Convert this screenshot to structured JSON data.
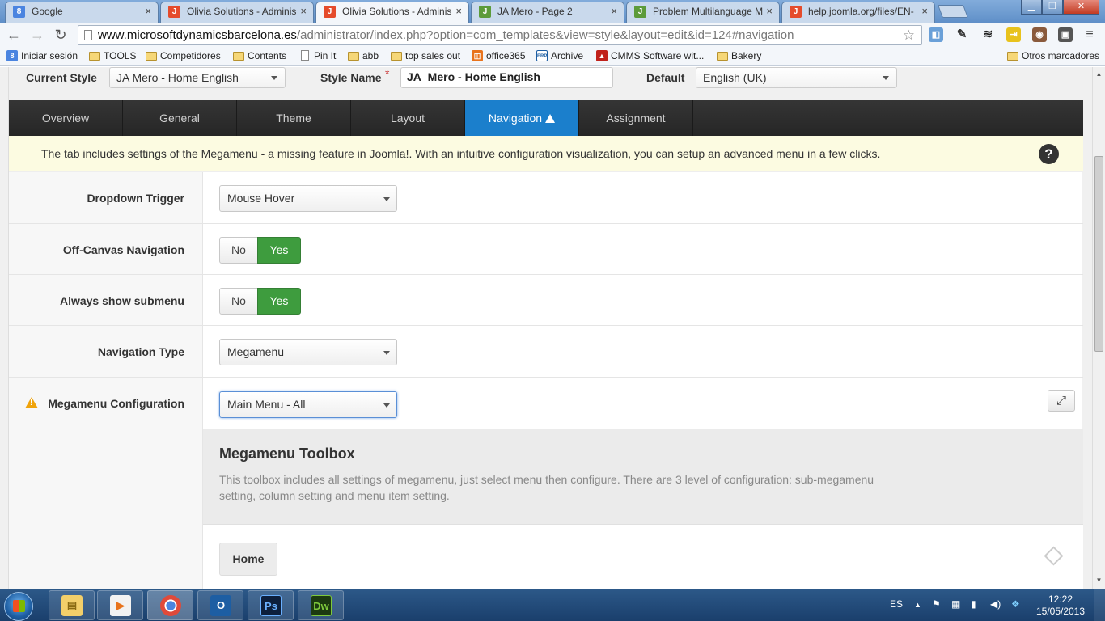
{
  "browser": {
    "tabs": [
      {
        "title": "Google",
        "favicon": "google-g-icon",
        "active": false
      },
      {
        "title": "Olivia Solutions - Adminis",
        "favicon": "joomla-icon",
        "active": false
      },
      {
        "title": "Olivia Solutions - Adminis",
        "favicon": "joomla-icon",
        "active": true
      },
      {
        "title": "JA Mero - Page 2",
        "favicon": "joomla-forum-icon",
        "active": false
      },
      {
        "title": "Problem Multilanguage M",
        "favicon": "joomla-forum-icon",
        "active": false
      },
      {
        "title": "help.joomla.org/files/EN-",
        "favicon": "joomla-icon",
        "active": false
      }
    ],
    "url_host": "www.microsoftdynamicsbarcelona.es",
    "url_path": "/administrator/index.php?option=com_templates&view=style&layout=edit&id=124#navigation",
    "bookmarks": [
      {
        "label": "Iniciar sesión",
        "icon": "google-icon"
      },
      {
        "label": "TOOLS",
        "icon": "folder-icon"
      },
      {
        "label": "Competidores",
        "icon": "folder-icon"
      },
      {
        "label": "Contents",
        "icon": "folder-icon"
      },
      {
        "label": "Pin It",
        "icon": "page-icon"
      },
      {
        "label": "abb",
        "icon": "folder-icon"
      },
      {
        "label": "top sales out",
        "icon": "folder-icon"
      },
      {
        "label": "office365",
        "icon": "office-icon"
      },
      {
        "label": "Archive",
        "icon": "erp-icon"
      },
      {
        "label": "CMMS Software wit...",
        "icon": "cmms-icon"
      },
      {
        "label": "Bakery",
        "icon": "folder-icon"
      }
    ],
    "other_bookmarks": "Otros marcadores"
  },
  "style_bar": {
    "current_style_label": "Current Style",
    "current_style_value": "JA Mero - Home English",
    "style_name_label": "Style Name",
    "style_name_required": "*",
    "style_name_value": "JA_Mero - Home English",
    "default_label": "Default",
    "default_value": "English (UK)"
  },
  "nav_tabs": [
    {
      "label": "Overview"
    },
    {
      "label": "General"
    },
    {
      "label": "Theme"
    },
    {
      "label": "Layout"
    },
    {
      "label": "Navigation",
      "active": true,
      "warning": true
    },
    {
      "label": "Assignment"
    }
  ],
  "notice": "The tab includes settings of the Megamenu - a missing feature in Joomla!. With an intuitive configuration visualization, you can setup an advanced menu in a few clicks.",
  "help_symbol": "?",
  "fields": {
    "dropdown_trigger": {
      "label": "Dropdown Trigger",
      "value": "Mouse Hover"
    },
    "off_canvas": {
      "label": "Off-Canvas Navigation",
      "no": "No",
      "yes": "Yes",
      "selected": "Yes"
    },
    "always_submenu": {
      "label": "Always show submenu",
      "no": "No",
      "yes": "Yes",
      "selected": "Yes"
    },
    "nav_type": {
      "label": "Navigation Type",
      "value": "Megamenu"
    },
    "megamenu_config": {
      "label": "Megamenu Configuration",
      "value": "Main Menu - All",
      "warning": true
    }
  },
  "toolbox": {
    "title": "Megamenu Toolbox",
    "description": "This toolbox includes all settings of megamenu, just select menu then configure. There are 3 level of configuration: sub-megamenu setting, column setting and menu item setting."
  },
  "menu_items": [
    {
      "label": "Home"
    }
  ],
  "taskbar": {
    "apps": [
      {
        "name": "explorer",
        "icon": "folder-icon"
      },
      {
        "name": "media-player",
        "icon": "media-player-icon"
      },
      {
        "name": "chrome",
        "icon": "chrome-icon"
      },
      {
        "name": "outlook",
        "label": "O",
        "icon": "outlook-icon"
      },
      {
        "name": "photoshop",
        "label": "Ps",
        "icon": "photoshop-icon"
      },
      {
        "name": "dreamweaver",
        "label": "Dw",
        "icon": "dreamweaver-icon"
      }
    ],
    "language": "ES",
    "time": "12:22",
    "date": "15/05/2013"
  },
  "colors": {
    "active_tab": "#1b7fcc",
    "toggle_yes": "#3e9c3e",
    "warning": "#f0a30a",
    "notice_bg": "#fcfbe1"
  }
}
